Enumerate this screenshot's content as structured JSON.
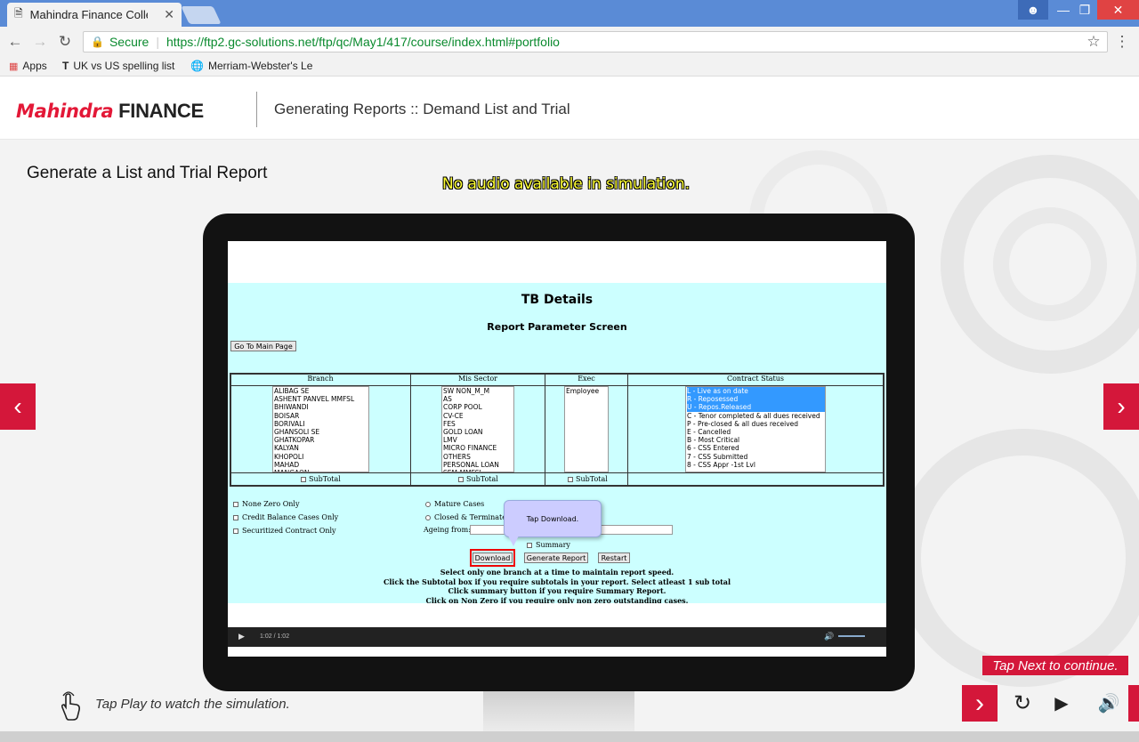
{
  "browser": {
    "tab_title": "Mahindra Finance Collec",
    "secure_label": "Secure",
    "url": "https://ftp2.gc-solutions.net/ftp/qc/May1/417/course/index.html#portfolio",
    "bookmarks": [
      "Apps",
      "UK vs US spelling list",
      "Merriam-Webster's Le"
    ]
  },
  "header": {
    "brand_mahindra": "Mahindra",
    "brand_finance": "FINANCE",
    "course_title": "Generating Reports :: Demand List and Trial"
  },
  "slide": {
    "title": "Generate a List and Trial Report",
    "audio_notice": "No audio available in simulation.",
    "tap_play": "Tap Play to watch the simulation.",
    "tap_next": "Tap Next to continue."
  },
  "sim": {
    "title": "TB Details",
    "subtitle": "Report Parameter Screen",
    "main_page_btn": "Go To Main Page",
    "columns": [
      "Branch",
      "Mis Sector",
      "Exec",
      "Contract Status"
    ],
    "branches": [
      "ALIBAG SE",
      "ASHENT PANVEL MMFSL",
      "BHIWANDI",
      "BOISAR",
      "BORIVALI",
      "GHANSOLI SE",
      "GHATKOPAR",
      "KALYAN",
      "KHOPOLI",
      "MAHAD",
      "MANGAON"
    ],
    "sectors": [
      "SW NON_M_M",
      "AS",
      "CORP POOL",
      "CV-CE",
      "FES",
      "GOLD LOAN",
      "LMV",
      "MICRO FINANCE",
      "OTHERS",
      "PERSONAL LOAN",
      "SEM-MMFSL"
    ],
    "exec": [
      "Employee"
    ],
    "statuses": [
      "L - Live as on date",
      "R - Reposessed",
      "U - Repos.Released",
      "C - Tenor completed & all dues received",
      "P - Pre-closed & all dues received",
      "E - Cancelled",
      "B - Most Critical",
      "6 - CSS Entered",
      "7 - CSS Submitted",
      "8 - CSS Appr -1st Lvl"
    ],
    "selected_statuses": 3,
    "subtotal": "SubTotal",
    "options_left": [
      "None Zero Only",
      "Credit Balance Cases Only",
      "Securitized Contract Only"
    ],
    "options_mid": [
      "Mature Cases",
      "Closed & Terminated"
    ],
    "ageing_label": "Ageing from:",
    "summary_label": "Summary",
    "btn_download": "Download",
    "btn_generate": "Generate Report",
    "btn_restart": "Restart",
    "tooltip": "Tap Download.",
    "notes": [
      "Select only one branch at a time to maintain report speed.",
      "Click the Subtotal box if you require subtotals in your report. Select atleast 1 sub total",
      "Click summary button if you require Summary Report.",
      "Click on Non Zero if you require only non zero outstanding cases."
    ],
    "video_time": "1:02 / 1:02"
  },
  "colors": {
    "accent": "#d4173a",
    "sim_bg": "#ccffff"
  }
}
